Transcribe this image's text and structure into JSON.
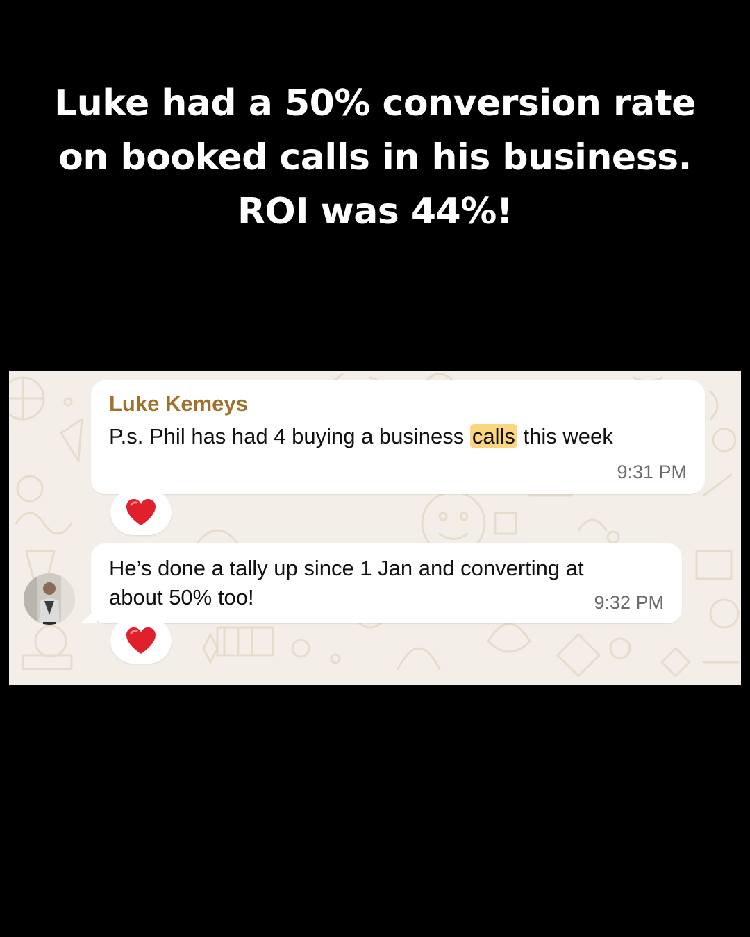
{
  "headline": {
    "line1": "Luke had a 50% conversion rate",
    "line2": "on booked calls in his business.",
    "line3": "ROI was 44%!"
  },
  "messages": [
    {
      "sender": "Luke Kemeys",
      "text_before": "P.s. Phil has had 4 buying a business ",
      "highlighted": "calls",
      "text_after": " this week",
      "time": "9:31 PM",
      "reaction_icon": "red-heart-icon"
    },
    {
      "line1": "He’s done a tally up since 1 Jan and converting at",
      "line2": "about 50% too!",
      "time": "9:32 PM",
      "reaction_icon": "red-heart-icon",
      "avatar_icon": "user-avatar"
    }
  ],
  "colors": {
    "background": "#000000",
    "headline_text": "#ffffff",
    "chat_background": "#f3efe8",
    "sender_name": "#a0712c",
    "highlight": "#fcd580",
    "heart": "#e0202a"
  }
}
